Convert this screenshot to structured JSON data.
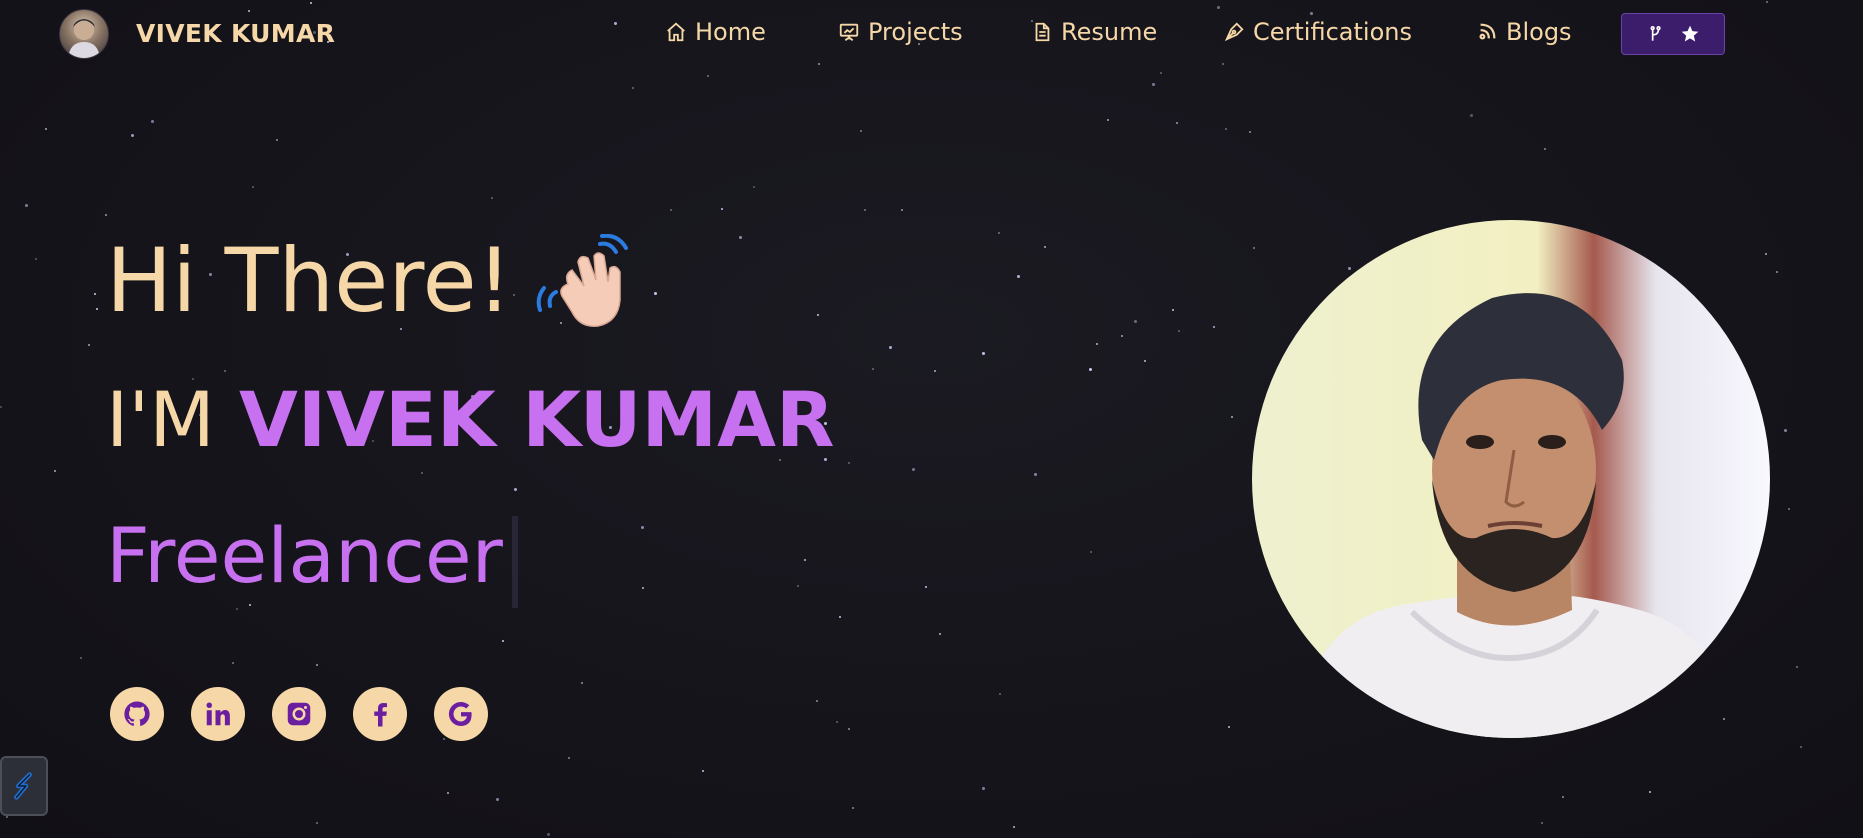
{
  "brand": {
    "name": "VIVEK KUMAR"
  },
  "nav": {
    "items": [
      {
        "label": "Home",
        "icon": "home-icon"
      },
      {
        "label": "Projects",
        "icon": "presentation-chart-icon"
      },
      {
        "label": "Resume",
        "icon": "document-icon"
      },
      {
        "label": "Certifications",
        "icon": "pen-nib-icon"
      },
      {
        "label": "Blogs",
        "icon": "rss-icon"
      }
    ],
    "github_button": {
      "icons": [
        "git-fork-icon",
        "star-icon"
      ]
    }
  },
  "hero": {
    "greeting": "Hi There!",
    "intro_prefix": "I'M ",
    "intro_name": "VIVEK KUMAR",
    "role": "Freelancer"
  },
  "social": [
    {
      "name": "github-icon"
    },
    {
      "name": "linkedin-icon"
    },
    {
      "name": "instagram-icon"
    },
    {
      "name": "facebook-icon"
    },
    {
      "name": "google-icon"
    }
  ],
  "colors": {
    "background": "#15141b",
    "accent_cream": "#f6d7a7",
    "accent_purple": "#c770f0",
    "button_purple": "#3b1d6b"
  }
}
